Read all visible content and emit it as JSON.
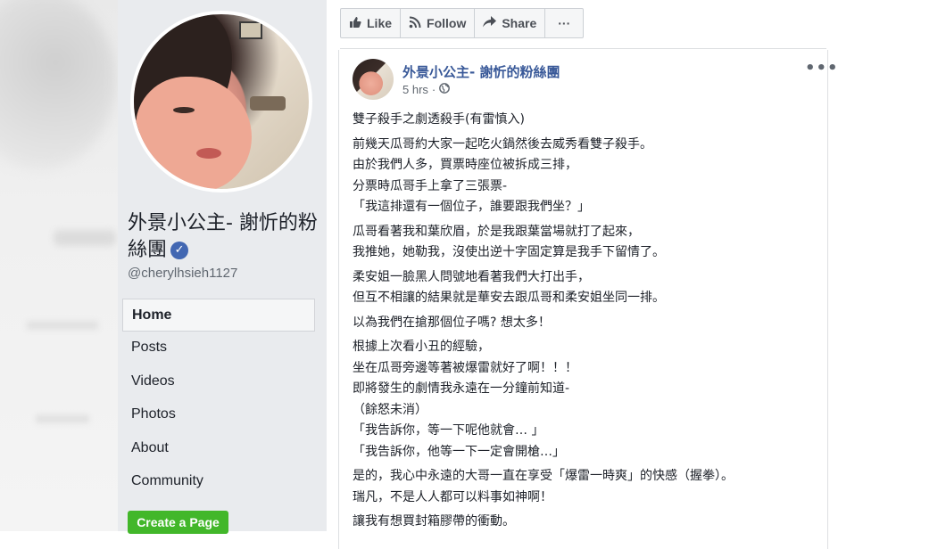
{
  "sidebar": {
    "page_name": "外景小公主- 謝忻的粉絲團",
    "handle": "@cherylhsieh1127",
    "nav": [
      "Home",
      "Posts",
      "Videos",
      "Photos",
      "About",
      "Community"
    ],
    "create_page_label": "Create a Page"
  },
  "actions": {
    "like": "Like",
    "follow": "Follow",
    "share": "Share",
    "more": "···"
  },
  "post": {
    "author": "外景小公主- 謝忻的粉絲團",
    "time": "5 hrs",
    "separator": "·",
    "menu": "•••",
    "paragraphs": [
      "雙子殺手之劇透殺手(有雷慎入)",
      "前幾天瓜哥約大家一起吃火鍋然後去威秀看雙子殺手。\n由於我們人多，買票時座位被拆成三排，\n分票時瓜哥手上拿了三張票-\n「我這排還有一個位子，誰要跟我們坐？」",
      "瓜哥看著我和葉欣眉，於是我跟葉當場就打了起來，\n我推她，她勒我，沒使出逆十字固定算是我手下留情了。",
      "柔安姐一臉黑人問號地看著我們大打出手，\n但互不相讓的結果就是華安去跟瓜哥和柔安姐坐同一排。",
      "以為我們在搶那個位子嗎? 想太多！",
      "根據上次看小丑的經驗，\n坐在瓜哥旁邊等著被爆雷就好了啊！！！\n即將發生的劇情我永遠在一分鐘前知道-\n（餘怒未消）\n「我告訴你，等一下呢他就會… 」\n「我告訴你，他等一下一定會開槍…」",
      "是的，我心中永遠的大哥一直在享受「爆雷一時爽」的快感（握拳）。\n瑞凡，不是人人都可以料事如神啊！",
      "讓我有想買封箱膠帶的衝動。"
    ]
  },
  "colors": {
    "link": "#385898",
    "create_button": "#42b72a",
    "verified": "#4267b2"
  }
}
